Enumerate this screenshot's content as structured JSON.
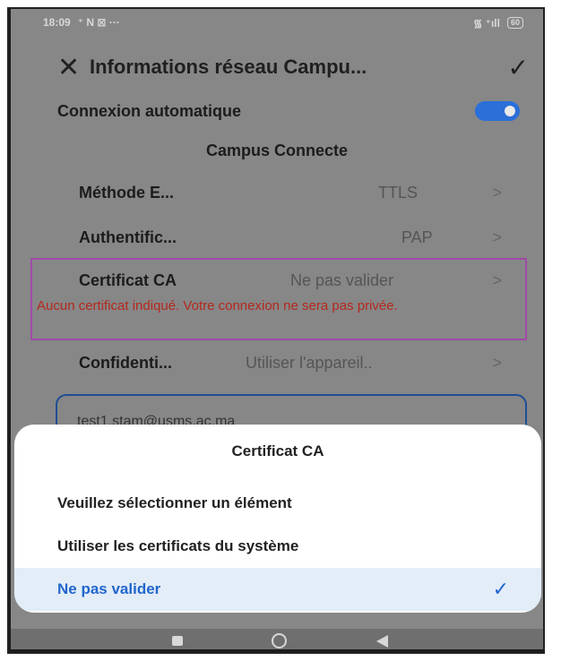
{
  "status_bar": {
    "time": "18:09",
    "icons_left": "⁺ N ⊠ ···",
    "battery": "60",
    "signal": "᯾ ⁺ıll"
  },
  "header": {
    "title": "Informations réseau Campu...",
    "close_icon": "close-icon",
    "confirm_icon": "check-icon"
  },
  "settings": {
    "auto_connect_label": "Connexion automatique",
    "auto_connect_on": true,
    "network_name": "Campus Connecte",
    "rows": [
      {
        "label": "Méthode E...",
        "value": "TTLS"
      },
      {
        "label": "Authentific...",
        "value": "PAP"
      },
      {
        "label": "Certificat CA",
        "value": "Ne pas valider"
      },
      {
        "label": "Confidenti...",
        "value": "Utiliser l'appareil.."
      }
    ],
    "chevron": ">",
    "ca_warning": "Aucun certificat indiqué. Votre connexion ne sera pas privée.",
    "identity_value": "test1.stam@usms.ac.ma"
  },
  "sheet": {
    "title": "Certificat CA",
    "options": [
      {
        "label": "Veuillez sélectionner un élément",
        "selected": false
      },
      {
        "label": "Utiliser les certificats du système",
        "selected": false
      },
      {
        "label": "Ne pas valider",
        "selected": true
      }
    ],
    "selected_mark": "✓"
  },
  "colors": {
    "accent": "#2266cc",
    "warning": "#b3281d",
    "highlight_border": "#a04aa8"
  }
}
